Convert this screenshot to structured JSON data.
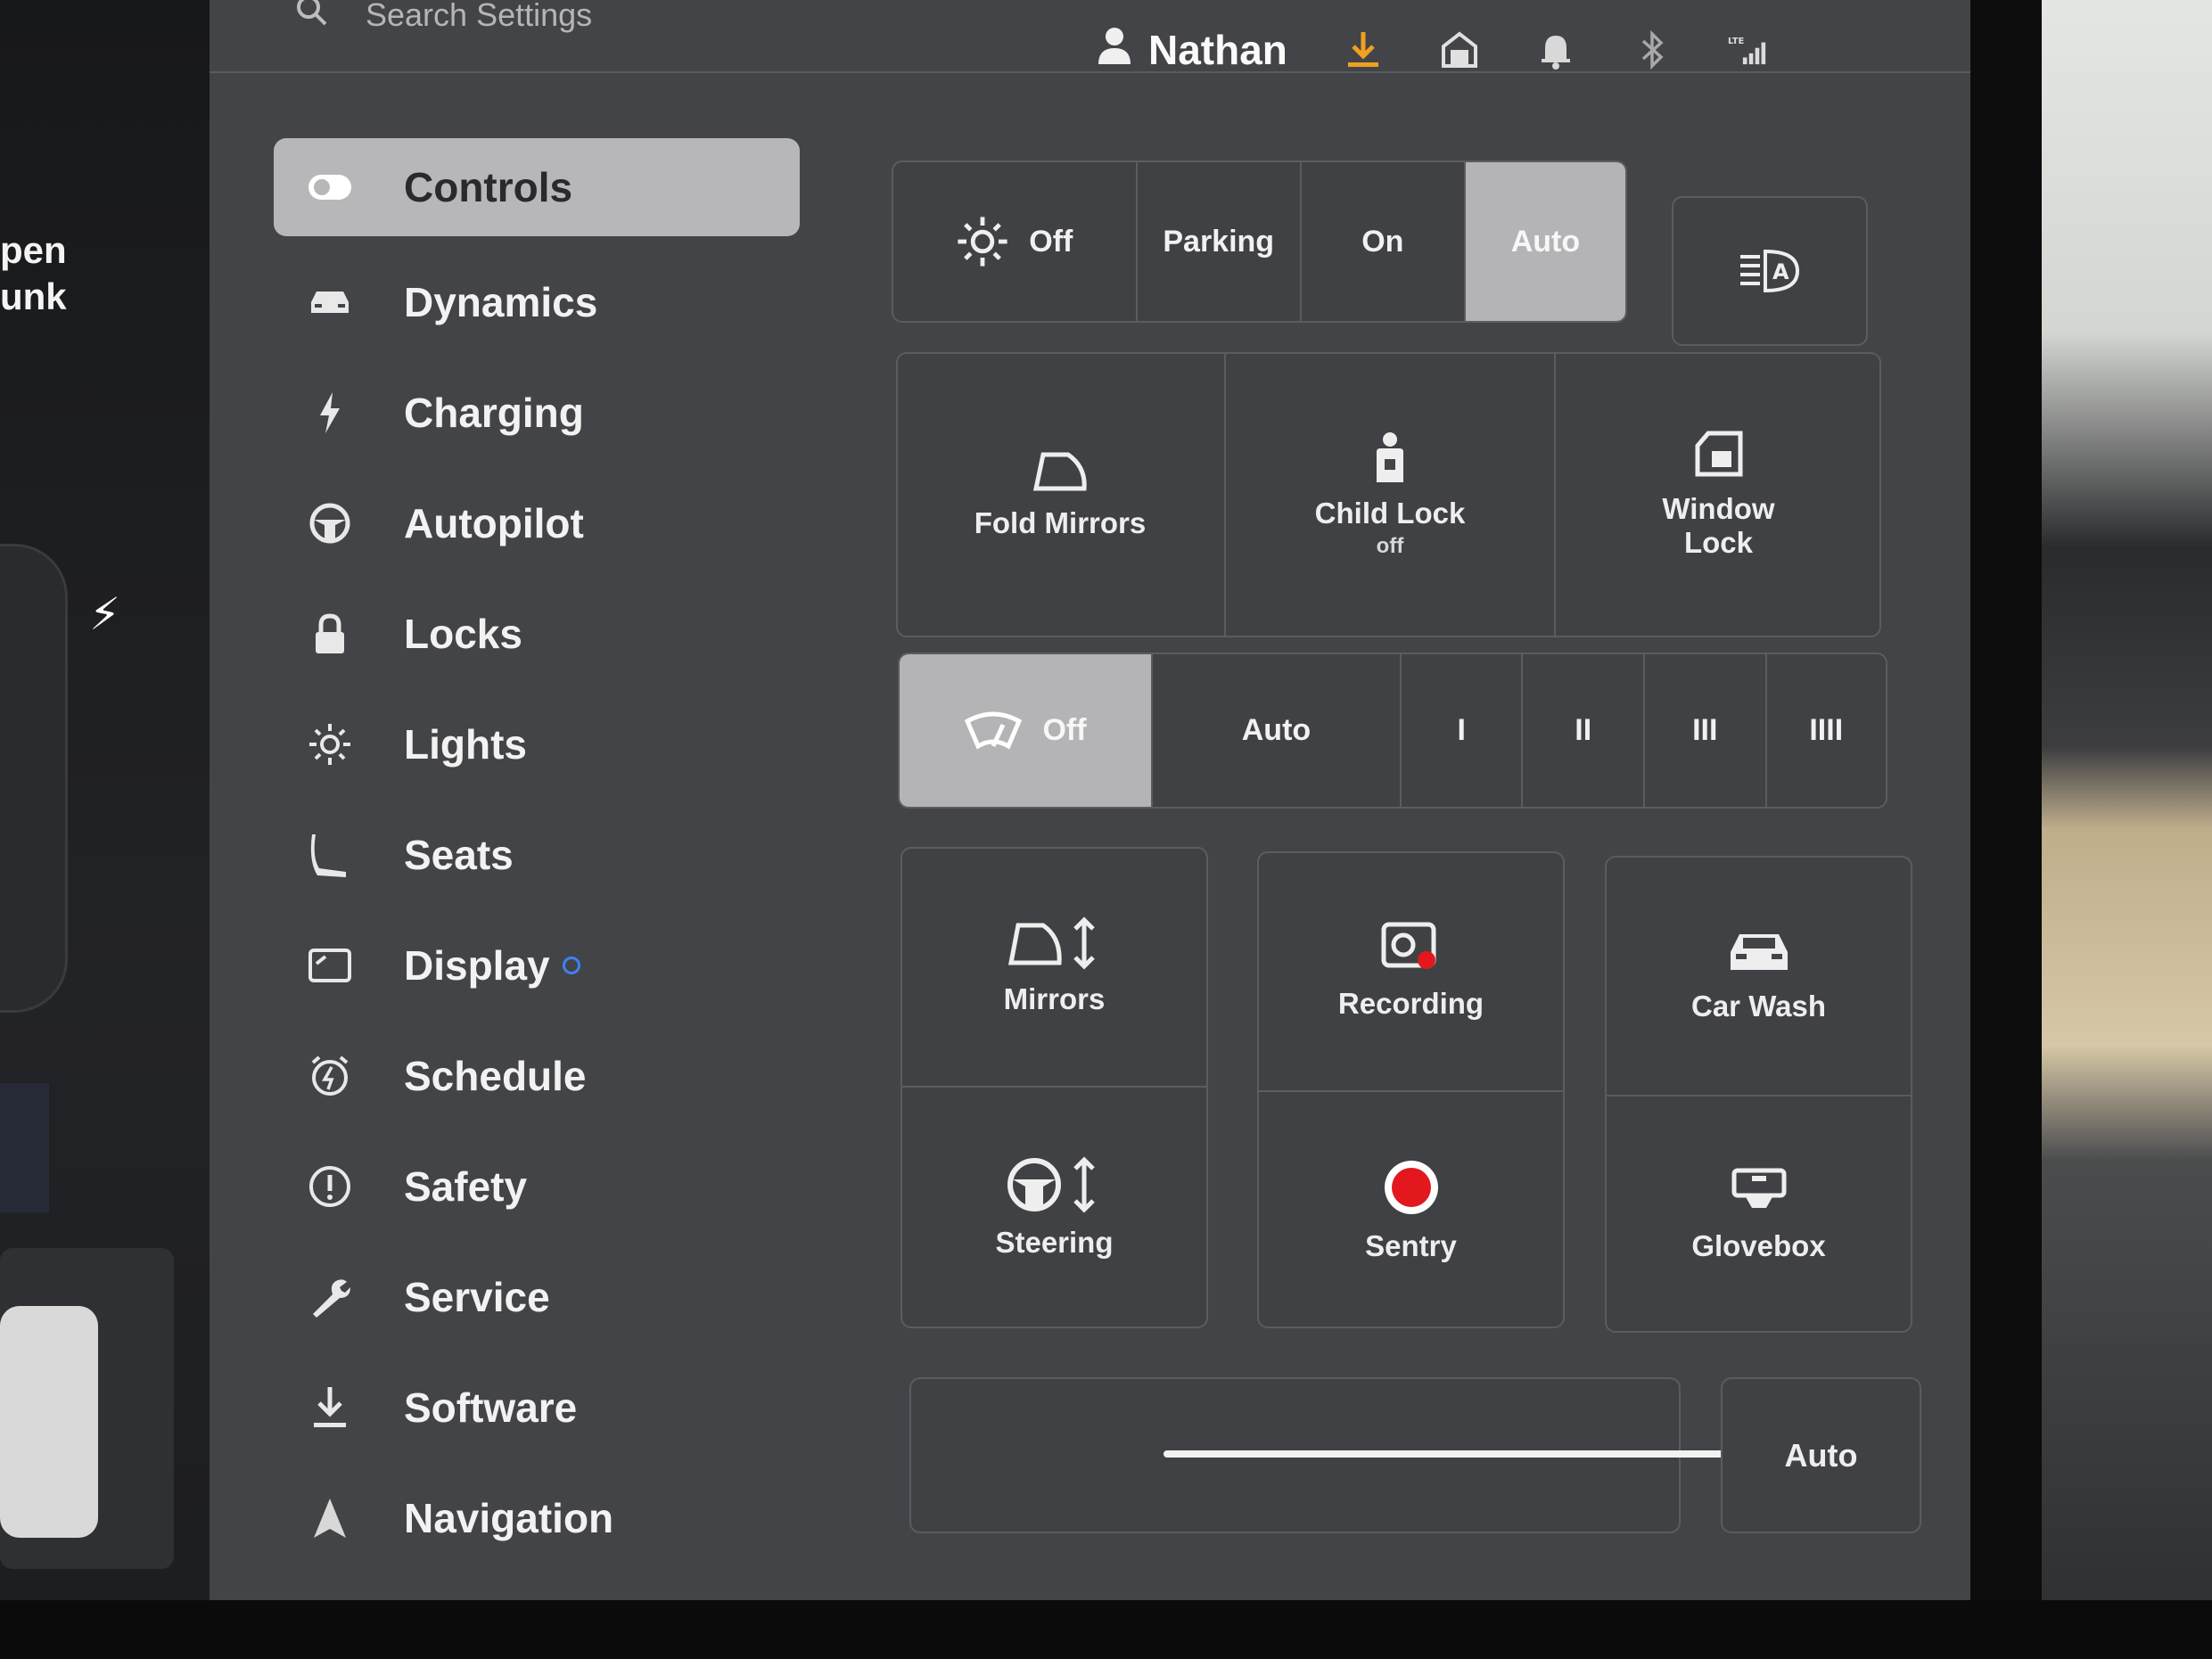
{
  "search": {
    "placeholder": "Search Settings"
  },
  "status_bar": {
    "user_name": "Nathan",
    "icons": [
      "download-icon",
      "garage-icon",
      "bell-icon",
      "bluetooth-icon",
      "lte-signal-icon"
    ],
    "download_color": "#f0a020"
  },
  "car_panel": {
    "trunk_label_1": "pen",
    "trunk_label_2": "unk"
  },
  "sidebar": {
    "items": [
      {
        "label": "Controls",
        "icon": "toggle-icon",
        "active": true
      },
      {
        "label": "Dynamics",
        "icon": "car-icon"
      },
      {
        "label": "Charging",
        "icon": "bolt-icon"
      },
      {
        "label": "Autopilot",
        "icon": "steering-wheel-icon"
      },
      {
        "label": "Locks",
        "icon": "lock-icon"
      },
      {
        "label": "Lights",
        "icon": "sun-icon"
      },
      {
        "label": "Seats",
        "icon": "seat-icon"
      },
      {
        "label": "Display",
        "icon": "display-icon",
        "badge": "blue-dot"
      },
      {
        "label": "Schedule",
        "icon": "alarm-clock-icon"
      },
      {
        "label": "Safety",
        "icon": "alert-circle-icon"
      },
      {
        "label": "Service",
        "icon": "wrench-icon"
      },
      {
        "label": "Software",
        "icon": "download-icon"
      },
      {
        "label": "Navigation",
        "icon": "navigation-arrow-icon"
      }
    ]
  },
  "lights": {
    "options": [
      "Off",
      "Parking",
      "On",
      "Auto"
    ],
    "selected": "Auto"
  },
  "quick_tiles": {
    "fold_mirrors": "Fold Mirrors",
    "child_lock": "Child Lock",
    "child_lock_state": "off",
    "window_lock": "Window",
    "window_lock_2": "Lock"
  },
  "wipers": {
    "options": [
      "Off",
      "Auto",
      "I",
      "II",
      "III",
      "IIII"
    ],
    "selected": "Off"
  },
  "grid_tiles": {
    "mirrors": "Mirrors",
    "recording": "Recording",
    "car_wash": "Car Wash",
    "steering": "Steering",
    "sentry": "Sentry",
    "glovebox": "Glovebox"
  },
  "brightness": {
    "auto_label": "Auto",
    "level": 0.95
  },
  "colors": {
    "screen_bg": "#434447",
    "selected": "#b4b4b6",
    "sentry_red": "#e3181f",
    "display_dot": "#3b82f6"
  }
}
